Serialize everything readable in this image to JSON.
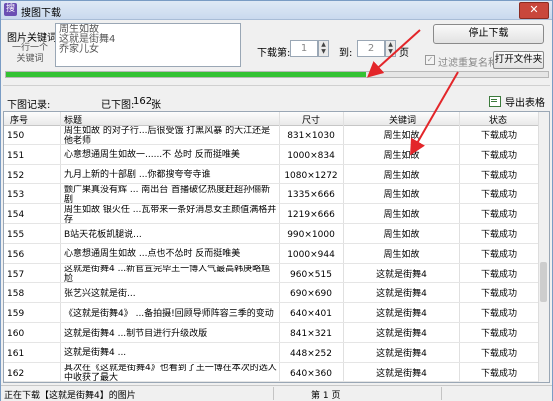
{
  "window": {
    "title": "搜图下载",
    "close_glyph": "✕"
  },
  "keywords": {
    "label": "图片关键词:",
    "hint": "一行一个关键词",
    "lines": [
      "周生如故",
      "这就是街舞4",
      "乔家儿女"
    ]
  },
  "download": {
    "page_label": "下载第:",
    "page_from": "1",
    "to_label": "到:",
    "page_to": "2",
    "page_unit": "页",
    "stop_button": "停止下载",
    "filter_label": "过滤重复名称",
    "open_folder_button": "打开文件夹"
  },
  "progress": {
    "fraction": 0.665
  },
  "stats": {
    "record_label": "下图记录:",
    "downloaded_label": "已下图:",
    "downloaded_count": "162",
    "downloaded_unit": "张",
    "export_label": "导出表格"
  },
  "table": {
    "columns": {
      "no": "序号",
      "title": "标题",
      "size": "尺寸",
      "keyword": "关键词",
      "status": "状态"
    },
    "rows": [
      {
        "no": "150",
        "title": "周生如故 的对子行...后很受饿 打黑风暴 的大江还是他老师",
        "size": "831×1030",
        "keyword": "周生如故",
        "status": "下载成功"
      },
      {
        "no": "151",
        "title": "心意想通周生如故一......不 怂时 反而挺唯美",
        "size": "1000×834",
        "keyword": "周生如故",
        "status": "下载成功"
      },
      {
        "no": "152",
        "title": "九月上新的十部剧 ...你都搜夸夸寺谁",
        "size": "1080×1272",
        "keyword": "周生如故",
        "status": "下载成功"
      },
      {
        "no": "153",
        "title": "颤广果真没有辉 ... 南出台 首播破亿热度赶超孙俪新剧",
        "size": "1335×666",
        "keyword": "周生如故",
        "status": "下载成功"
      },
      {
        "no": "154",
        "title": "周生如故 银火任 ...瓦带来一条好消息女主颜值满格并存",
        "size": "1219×666",
        "keyword": "周生如故",
        "status": "下载成功"
      },
      {
        "no": "155",
        "title": "B站天花板凯腿说...",
        "size": "990×1000",
        "keyword": "周生如故",
        "status": "下载成功"
      },
      {
        "no": "156",
        "title": "心意想通周生如故 ...点也不怂时 反而挺唯美",
        "size": "1000×944",
        "keyword": "周生如故",
        "status": "下载成功"
      },
      {
        "no": "157",
        "title": "这就是街舞4 ...新官宣完毕王一博人气最高韩庚略尴尬",
        "size": "960×515",
        "keyword": "这就是街舞4",
        "status": "下载成功"
      },
      {
        "no": "158",
        "title": "张艺兴这就是街...",
        "size": "690×690",
        "keyword": "这就是街舞4",
        "status": "下载成功"
      },
      {
        "no": "159",
        "title": "《这就是街舞4》 ...备拍摄!回顾导师阵容三季的变动",
        "size": "640×401",
        "keyword": "这就是街舞4",
        "status": "下载成功"
      },
      {
        "no": "160",
        "title": "这就是街舞4 ...制节目进行升级改版",
        "size": "841×321",
        "keyword": "这就是街舞4",
        "status": "下载成功"
      },
      {
        "no": "161",
        "title": "这就是街舞4 ...",
        "size": "448×252",
        "keyword": "这就是街舞4",
        "status": "下载成功"
      },
      {
        "no": "162",
        "title": "其次在《这就是街舞4》也看到了王一博在本次的选人中收获了最大",
        "size": "640×360",
        "keyword": "这就是街舞4",
        "status": "下载成功"
      }
    ]
  },
  "statusbar": {
    "message": "正在下载【这就是街舞4】的图片",
    "page": "第 1 页"
  },
  "colors": {
    "progress": "#33c233",
    "arrow": "#e3262a",
    "close": "#c9473c"
  }
}
